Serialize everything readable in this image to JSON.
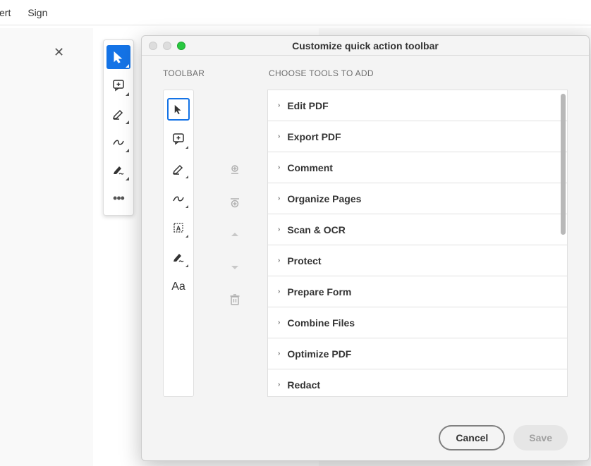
{
  "top_menu": {
    "item1": "vert",
    "item2": "Sign"
  },
  "dialog": {
    "title": "Customize quick action toolbar",
    "section_toolbar": "TOOLBAR",
    "section_choose": "CHOOSE TOOLS TO ADD",
    "cancel": "Cancel",
    "save": "Save"
  },
  "side_toolbar_items": [
    {
      "name": "cursor",
      "active": true
    },
    {
      "name": "add-comment",
      "active": false
    },
    {
      "name": "highlight",
      "active": false
    },
    {
      "name": "draw",
      "active": false
    },
    {
      "name": "sign",
      "active": false
    },
    {
      "name": "more",
      "active": false
    }
  ],
  "dialog_toolbar_items": [
    {
      "name": "cursor",
      "selected": true
    },
    {
      "name": "add-comment",
      "selected": false
    },
    {
      "name": "highlight",
      "selected": false
    },
    {
      "name": "draw",
      "selected": false
    },
    {
      "name": "text-select",
      "selected": false
    },
    {
      "name": "sign",
      "selected": false
    },
    {
      "name": "text-aa",
      "selected": false
    }
  ],
  "tool_list": [
    {
      "label": "Edit PDF"
    },
    {
      "label": "Export PDF"
    },
    {
      "label": "Comment"
    },
    {
      "label": "Organize Pages"
    },
    {
      "label": "Scan & OCR"
    },
    {
      "label": "Protect"
    },
    {
      "label": "Prepare Form"
    },
    {
      "label": "Combine Files"
    },
    {
      "label": "Optimize PDF"
    },
    {
      "label": "Redact"
    }
  ]
}
